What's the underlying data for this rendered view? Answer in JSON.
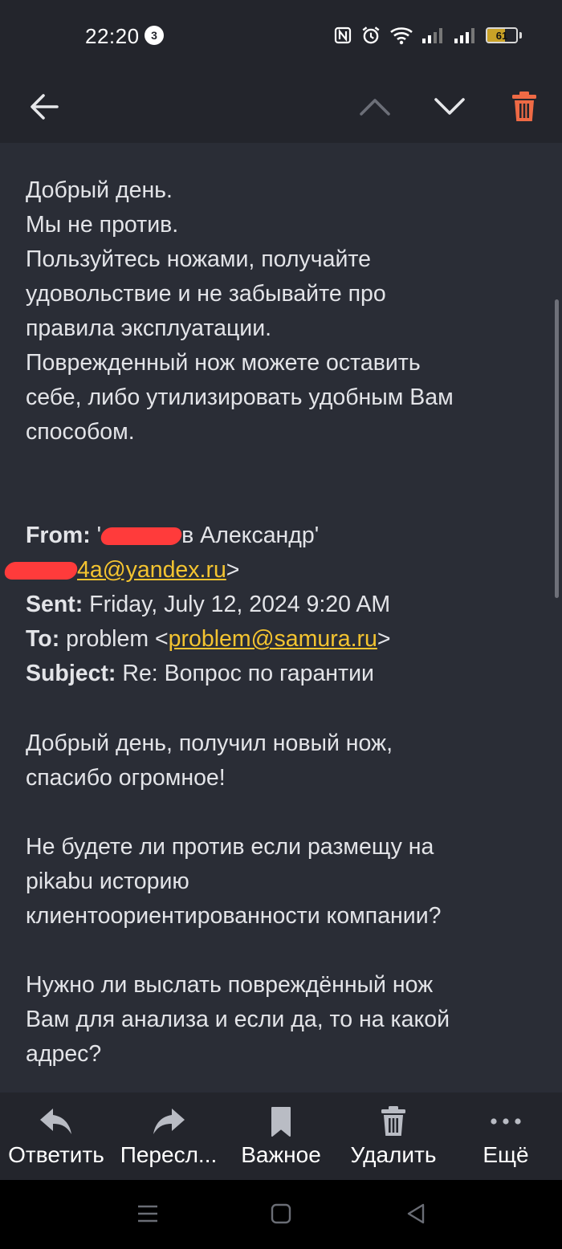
{
  "status": {
    "time": "22:20",
    "notification_count": "3",
    "battery": "61",
    "battery_level": 0.61,
    "icons": [
      "nfc-icon",
      "alarm-icon",
      "wifi-icon",
      "signal-icon",
      "signal-icon",
      "battery-icon"
    ]
  },
  "toolbar": {
    "icons": [
      "back-arrow-icon",
      "chevron-up-icon",
      "chevron-down-icon",
      "trash-icon"
    ],
    "colors": {
      "delete": "#ee6a45",
      "disabled_chevron": "#6c6f78",
      "active": "#e6e7ea"
    }
  },
  "reply": [
    "Добрый день.",
    "Мы не против.",
    "Пользуйтесь ножами, получайте",
    "удовольствие и не забывайте про",
    "правила эксплуатации.",
    "Поврежденный нож можете оставить",
    "себе, либо утилизировать удобным Вам",
    "способом."
  ],
  "quoted_header": {
    "from_label": "From:",
    "from_open": "'",
    "from_name": "в Александр'",
    "from_email_link": "4a@yandex.ru",
    "from_email_close": ">",
    "sent_label": "Sent:",
    "sent_value": "Friday, July 12, 2024 9:20 AM",
    "to_label": "To:",
    "to_name": "problem <",
    "to_email_link": "problem@samura.ru",
    "to_close": ">",
    "subject_label": "Subject:",
    "subject_value": "Re: Вопрос по гарантии"
  },
  "quoted_body": {
    "p1": [
      "Добрый день, получил новый нож,",
      "спасибо огромное!"
    ],
    "p2": [
      "Не будете ли против если размещу на",
      "pikabu историю",
      "клиентоориентированности компании?"
    ],
    "p3": [
      "Нужно ли выслать повреждённый нож",
      "Вам для анализа и если да, то на какой",
      "адрес?"
    ]
  },
  "colors": {
    "link": "#f4c430",
    "redaction": "#ff3b3b",
    "background": "#2a2d36",
    "bars": "#23252c"
  },
  "bottom_bar": {
    "reply": "Ответить",
    "forward": "Пересл...",
    "important": "Важное",
    "delete": "Удалить",
    "more": "Ещё"
  },
  "nav": {
    "icons": [
      "menu-icon",
      "home-icon",
      "back-triangle-icon"
    ]
  }
}
